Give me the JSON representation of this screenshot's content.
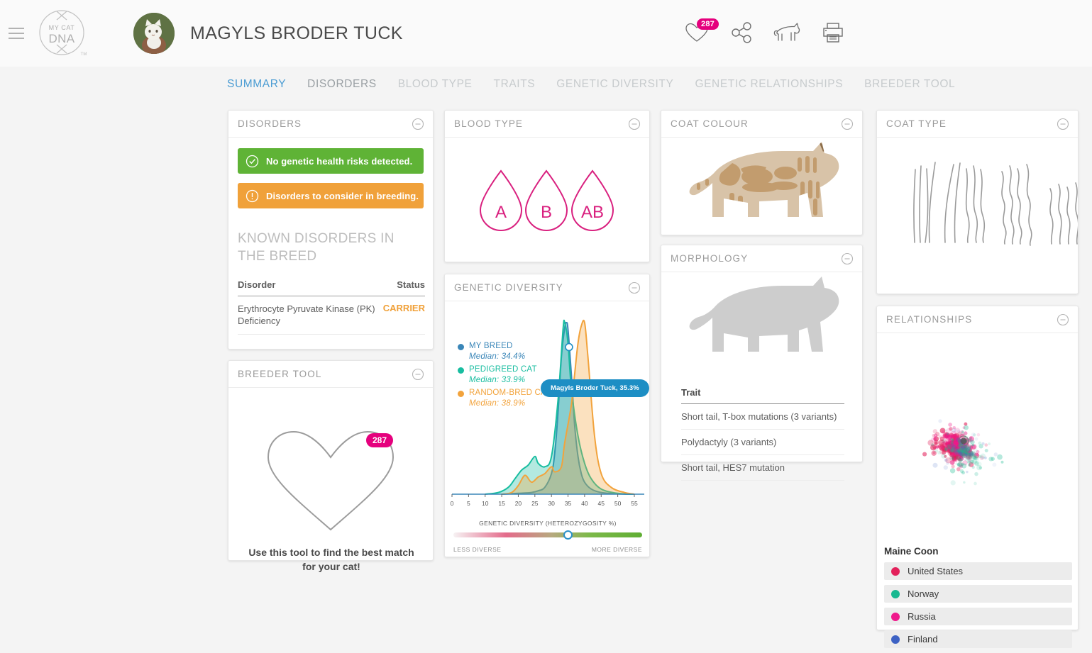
{
  "header": {
    "menu_icon": "hamburger-menu-icon",
    "logo_line1": "MY CAT",
    "logo_line2": "DNA",
    "logo_tm": "TM",
    "cat_name": "MAGYLS BRODER TUCK",
    "icons": [
      {
        "name": "heart-icon",
        "badge": "287"
      },
      {
        "name": "share-icon",
        "badge": ""
      },
      {
        "name": "cat-icon",
        "badge": ""
      },
      {
        "name": "print-icon",
        "badge": ""
      }
    ]
  },
  "tabs": [
    {
      "label": "SUMMARY",
      "state": "active"
    },
    {
      "label": "DISORDERS",
      "state": "semi"
    },
    {
      "label": "BLOOD TYPE",
      "state": "inactive"
    },
    {
      "label": "TRAITS",
      "state": "inactive"
    },
    {
      "label": "GENETIC DIVERSITY",
      "state": "inactive"
    },
    {
      "label": "GENETIC RELATIONSHIPS",
      "state": "inactive"
    },
    {
      "label": "BREEDER TOOL",
      "state": "inactive"
    }
  ],
  "disorders": {
    "title": "DISORDERS",
    "banner_ok": "No genetic health risks detected.",
    "banner_warn": "Disorders to consider in breeding.",
    "known_heading": "KNOWN DISORDERS IN THE BREED",
    "col_disorder": "Disorder",
    "col_status": "Status",
    "rows": [
      {
        "disorder": "Erythrocyte Pyruvate Kinase (PK) Deficiency",
        "status": "CARRIER"
      }
    ]
  },
  "breeder": {
    "title": "BREEDER TOOL",
    "badge": "287",
    "caption": "Use this tool to find the best match for your cat!"
  },
  "blood": {
    "title": "BLOOD TYPE",
    "types": [
      "A",
      "B",
      "AB"
    ]
  },
  "coat_colour": {
    "title": "COAT COLOUR"
  },
  "coat_type": {
    "title": "COAT TYPE"
  },
  "morphology": {
    "title": "MORPHOLOGY",
    "col_trait": "Trait",
    "traits": [
      "Short tail, T-box mutations (3 variants)",
      "Polydactyly (3 variants)",
      "Short tail, HES7 mutation"
    ]
  },
  "relationships": {
    "title": "RELATIONSHIPS",
    "breed": "Maine Coon",
    "countries": [
      {
        "label": "United States",
        "color": "#e3215b"
      },
      {
        "label": "Norway",
        "color": "#17b890"
      },
      {
        "label": "Russia",
        "color": "#ef1a8c"
      },
      {
        "label": "Finland",
        "color": "#3d62c4"
      }
    ]
  },
  "chart_data": {
    "type": "area",
    "title": "GENETIC DIVERSITY",
    "xlabel": "GENETIC DIVERSITY (HETEROZYGOSITY %)",
    "ylabel": "",
    "xlim": [
      0,
      58
    ],
    "ticks": [
      0,
      5,
      10,
      15,
      20,
      25,
      30,
      35,
      40,
      45,
      50,
      55
    ],
    "grid": false,
    "legend_position": "top-left",
    "series": [
      {
        "name": "MY BREED",
        "median_label": "Median: 34.4%",
        "median": 34.4,
        "color": "#3a86b8",
        "x": [
          15,
          20,
          24,
          26,
          28,
          30,
          31,
          32,
          33,
          34,
          34.5,
          35,
          36,
          37,
          38,
          39,
          40,
          42,
          45,
          50,
          55
        ],
        "values": [
          0,
          0.5,
          1,
          2,
          4,
          12,
          24,
          48,
          80,
          97,
          100,
          96,
          70,
          40,
          22,
          12,
          7,
          3,
          1,
          0.2,
          0
        ]
      },
      {
        "name": "PEDIGREED CAT",
        "median_label": "Median: 33.9%",
        "median": 33.9,
        "color": "#18bda0",
        "x": [
          10,
          14,
          17,
          19,
          21,
          23,
          25,
          26,
          28,
          30,
          32,
          33.5,
          34,
          35,
          36,
          38,
          40,
          42,
          45,
          50,
          55
        ],
        "values": [
          0,
          1,
          4,
          9,
          14,
          17,
          22,
          18,
          16,
          22,
          55,
          96,
          100,
          88,
          62,
          34,
          18,
          9,
          3,
          0.5,
          0
        ]
      },
      {
        "name": "RANDOM-BRED CAT",
        "median_label": "Median: 38.9%",
        "median": 38.9,
        "color": "#f2a33c",
        "x": [
          15,
          18,
          20,
          22,
          24,
          26,
          28,
          30,
          31,
          33,
          34,
          36,
          37,
          38,
          39,
          40,
          41,
          43,
          45,
          48,
          52,
          55
        ],
        "values": [
          0,
          1,
          5,
          11,
          7,
          10,
          12,
          16,
          13,
          16,
          30,
          52,
          70,
          88,
          98,
          100,
          80,
          34,
          12,
          4,
          1,
          0
        ]
      }
    ],
    "marker": {
      "x": 35.3,
      "label": "Magyls Broder Tuck, 35.3%",
      "value": 35.3,
      "color": "#1d8ec4"
    },
    "slider": {
      "left_label": "LESS DIVERSE",
      "right_label": "MORE DIVERSE",
      "position_pct": 59
    }
  }
}
